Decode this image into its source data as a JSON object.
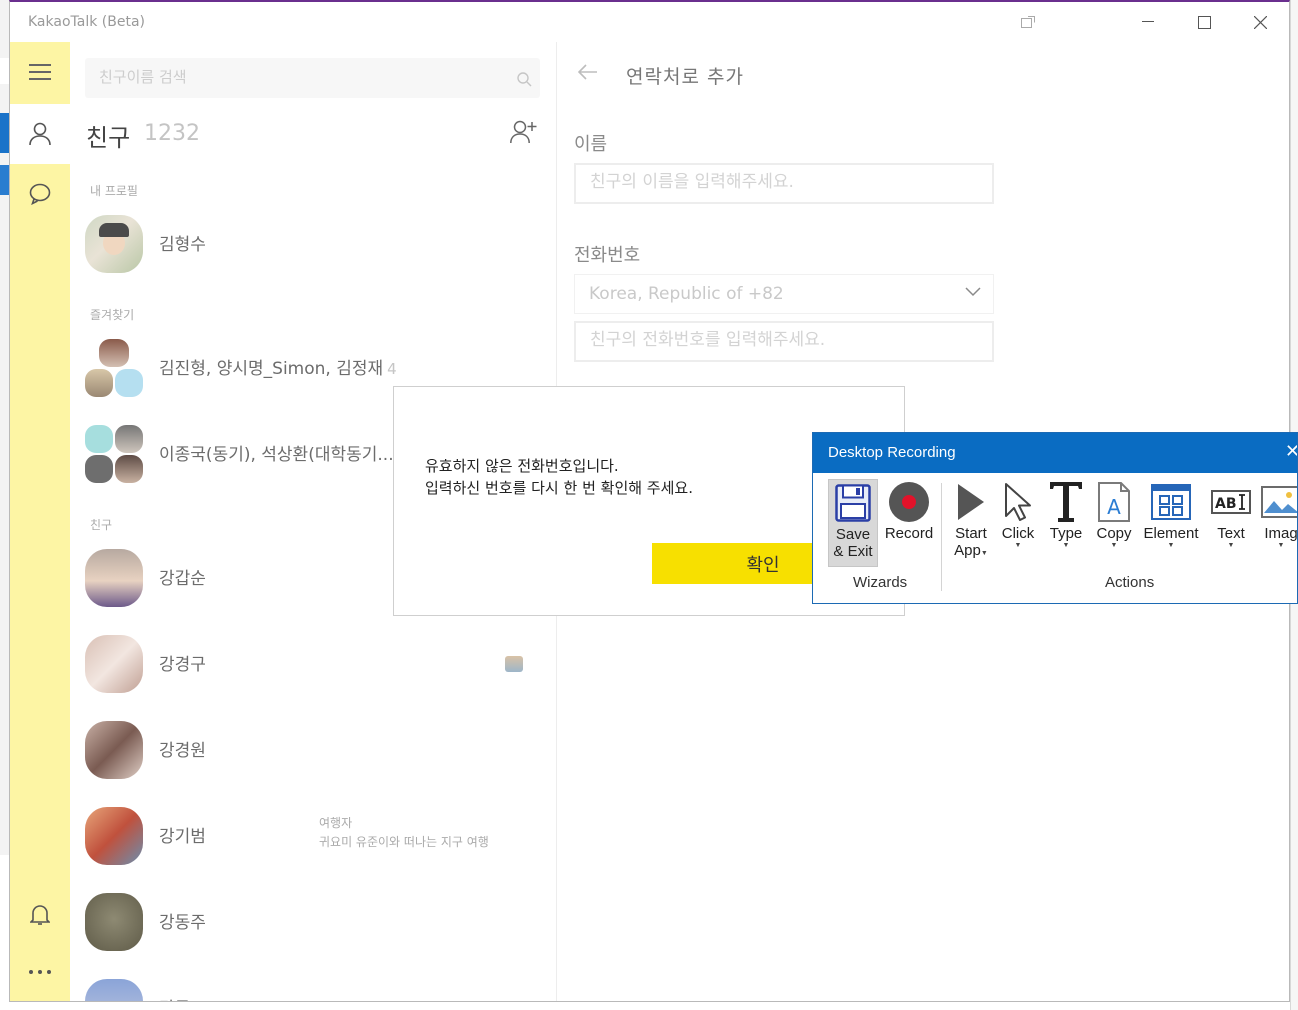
{
  "window": {
    "title": "KakaoTalk (Beta)"
  },
  "search": {
    "placeholder": "친구이름 검색"
  },
  "friends": {
    "title": "친구",
    "count": "1232",
    "sections": {
      "my_profile": "내 프로필",
      "favorites": "즐겨찾기",
      "friends": "친구"
    },
    "my_profile": {
      "name": "김형수"
    },
    "favorites": [
      {
        "name": "김진형, 양시명_Simon, 김정재",
        "count": "4"
      },
      {
        "name": "이종국(동기), 석상환(대학동기..."
      }
    ],
    "list": [
      {
        "name": "강갑순"
      },
      {
        "name": "강경구"
      },
      {
        "name": "강경원"
      },
      {
        "name": "강기범",
        "status_line1": "여행자",
        "status_line2": "귀요미 유준이와 떠나는 지구 여행"
      },
      {
        "name": "강동주"
      },
      {
        "name": "강동..."
      }
    ]
  },
  "add_contact": {
    "title": "연락처로 추가",
    "name_label": "이름",
    "name_placeholder": "친구의 이름을 입력해주세요.",
    "phone_label": "전화번호",
    "country": "Korea, Republic of   +82",
    "phone_placeholder": "친구의 전화번호를 입력해주세요."
  },
  "alert": {
    "line1": "유효하지 않은 전화번호입니다.",
    "line2": "입력하신 번호를 다시 한 번 확인해 주세요.",
    "ok": "확인"
  },
  "recorder": {
    "title": "Desktop Recording",
    "wizards": {
      "group": "Wizards",
      "save_1": "Save",
      "save_2": "& Exit",
      "record": "Record"
    },
    "actions": {
      "group": "Actions",
      "start_1": "Start",
      "start_2": "App",
      "click": "Click",
      "type": "Type",
      "copy": "Copy",
      "element": "Element",
      "text": "Text",
      "image": "Imag"
    }
  },
  "colors": {
    "sidebar": "#fdf5a4",
    "ok_button": "#f7e000",
    "recorder_header": "#0a6cc2",
    "title_accent": "#6a2f8e"
  }
}
